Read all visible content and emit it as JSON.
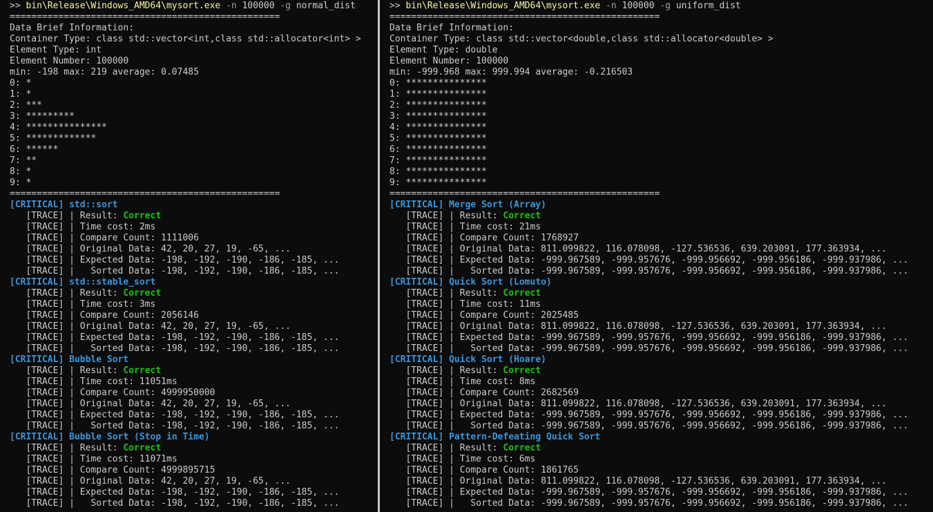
{
  "panes": [
    {
      "prompt": ">> ",
      "exe": "bin\\Release\\Windows_AMD64\\mysort.exe",
      "args": [
        {
          "text": "-n",
          "type": "flag"
        },
        {
          "text": "100000",
          "type": "value"
        },
        {
          "text": "-g",
          "type": "flag"
        },
        {
          "text": "normal_dist",
          "type": "value"
        }
      ],
      "separator": "==================================================",
      "info": [
        "Data Brief Information:",
        "Container Type: class std::vector<int,class std::allocator<int> >",
        "Element Type: int",
        "Element Number: 100000",
        "min: -198 max: 219 average: 0.07485"
      ],
      "histogram": [
        "0: *",
        "1: *",
        "2: ***",
        "3: *********",
        "4: ***************",
        "5: *************",
        "6: ******",
        "7: **",
        "8: *",
        "9: *"
      ],
      "critical_label": "[CRITICAL]",
      "trace_label": "[TRACE]",
      "results": [
        {
          "name": "std::sort",
          "status": "Correct",
          "time": "2ms",
          "compare": "1111006",
          "original": "42, 20, 27, 19, -65, ...",
          "expected": "-198, -192, -190, -186, -185, ...",
          "sorted": "-198, -192, -190, -186, -185, ..."
        },
        {
          "name": "std::stable_sort",
          "status": "Correct",
          "time": "3ms",
          "compare": "2056146",
          "original": "42, 20, 27, 19, -65, ...",
          "expected": "-198, -192, -190, -186, -185, ...",
          "sorted": "-198, -192, -190, -186, -185, ..."
        },
        {
          "name": "Bubble Sort",
          "status": "Correct",
          "time": "11051ms",
          "compare": "4999950000",
          "original": "42, 20, 27, 19, -65, ...",
          "expected": "-198, -192, -190, -186, -185, ...",
          "sorted": "-198, -192, -190, -186, -185, ..."
        },
        {
          "name": "Bubble Sort (Stop in Time)",
          "status": "Correct",
          "time": "11071ms",
          "compare": "4999895715",
          "original": "42, 20, 27, 19, -65, ...",
          "expected": "-198, -192, -190, -186, -185, ...",
          "sorted": "-198, -192, -190, -186, -185, ..."
        }
      ]
    },
    {
      "prompt": ">> ",
      "exe": "bin\\Release\\Windows_AMD64\\mysort.exe",
      "args": [
        {
          "text": "-n",
          "type": "flag"
        },
        {
          "text": "100000",
          "type": "value"
        },
        {
          "text": "-g",
          "type": "flag"
        },
        {
          "text": "uniform_dist",
          "type": "value"
        }
      ],
      "separator": "==================================================",
      "info": [
        "Data Brief Information:",
        "Container Type: class std::vector<double,class std::allocator<double> >",
        "Element Type: double",
        "Element Number: 100000",
        "min: -999.968 max: 999.994 average: -0.216503"
      ],
      "histogram": [
        "0: ***************",
        "1: ***************",
        "2: ***************",
        "3: ***************",
        "4: ***************",
        "5: ***************",
        "6: ***************",
        "7: ***************",
        "8: ***************",
        "9: ***************"
      ],
      "critical_label": "[CRITICAL]",
      "trace_label": "[TRACE]",
      "results": [
        {
          "name": "Merge Sort (Array)",
          "status": "Correct",
          "time": "21ms",
          "compare": "1768927",
          "original": "811.099822, 116.078098, -127.536536, 639.203091, 177.363934, ...",
          "expected": "-999.967589, -999.957676, -999.956692, -999.956186, -999.937986, ...",
          "sorted": "-999.967589, -999.957676, -999.956692, -999.956186, -999.937986, ..."
        },
        {
          "name": "Quick Sort (Lomuto)",
          "status": "Correct",
          "time": "11ms",
          "compare": "2025485",
          "original": "811.099822, 116.078098, -127.536536, 639.203091, 177.363934, ...",
          "expected": "-999.967589, -999.957676, -999.956692, -999.956186, -999.937986, ...",
          "sorted": "-999.967589, -999.957676, -999.956692, -999.956186, -999.937986, ..."
        },
        {
          "name": "Quick Sort (Hoare)",
          "status": "Correct",
          "time": "8ms",
          "compare": "2682569",
          "original": "811.099822, 116.078098, -127.536536, 639.203091, 177.363934, ...",
          "expected": "-999.967589, -999.957676, -999.956692, -999.956186, -999.937986, ...",
          "sorted": "-999.967589, -999.957676, -999.956692, -999.956186, -999.937986, ..."
        },
        {
          "name": "Pattern-Defeating Quick Sort",
          "status": "Correct",
          "time": "6ms",
          "compare": "1861765",
          "original": "811.099822, 116.078098, -127.536536, 639.203091, 177.363934, ...",
          "expected": "-999.967589, -999.957676, -999.956692, -999.956186, -999.937986, ...",
          "sorted": "-999.967589, -999.957676, -999.956692, -999.956186, -999.937986, ..."
        }
      ]
    }
  ],
  "labels": {
    "result": "| Result: ",
    "time": "| Time cost: ",
    "compare": "| Compare Count: ",
    "original": "| Original Data: ",
    "expected": "| Expected Data: ",
    "sorted": "|   Sorted Data: "
  },
  "colors": {
    "background": "#0c0c0c",
    "text": "#cccccc",
    "exe": "#f9f1a5",
    "flag": "#9e9e9e",
    "critical": "#3a96dd",
    "correct": "#16c60c"
  }
}
